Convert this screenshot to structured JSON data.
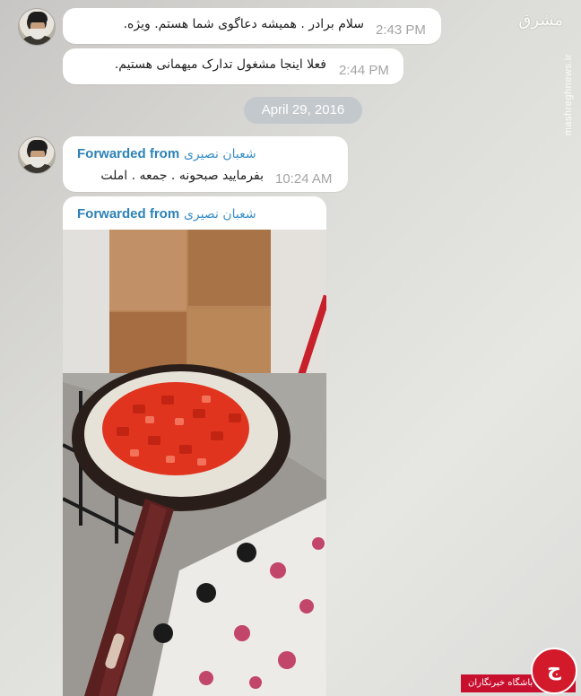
{
  "messages": [
    {
      "text": "سلام برادر . همیشه دعاگوی شما هستم.  ویژه.",
      "time": "2:43 PM"
    },
    {
      "text": "فعلا اینجا مشغول تدارک میهمانی هستیم.",
      "time": "2:44 PM"
    }
  ],
  "date_separator": "April 29, 2016",
  "forwarded": [
    {
      "label": "Forwarded from",
      "name": "شعبان نصیری",
      "text": "بفرمایید صبحونه . جمعه . املت",
      "time": "10:24 AM"
    },
    {
      "label": "Forwarded from",
      "name": "شعبان نصیری",
      "photo": "frying-pan-with-tomatoes-on-stove"
    }
  ],
  "watermark": {
    "logo": "مشرق",
    "url": "mashreghnews.ir"
  },
  "badge": {
    "text": "باشگاه خبرنگاران",
    "letter": "ج"
  },
  "colors": {
    "forwarded_label": "#2d82b8",
    "time": "#a4a4a4",
    "date_pill": "#c3c8cc",
    "badge_red": "#c8102e"
  }
}
